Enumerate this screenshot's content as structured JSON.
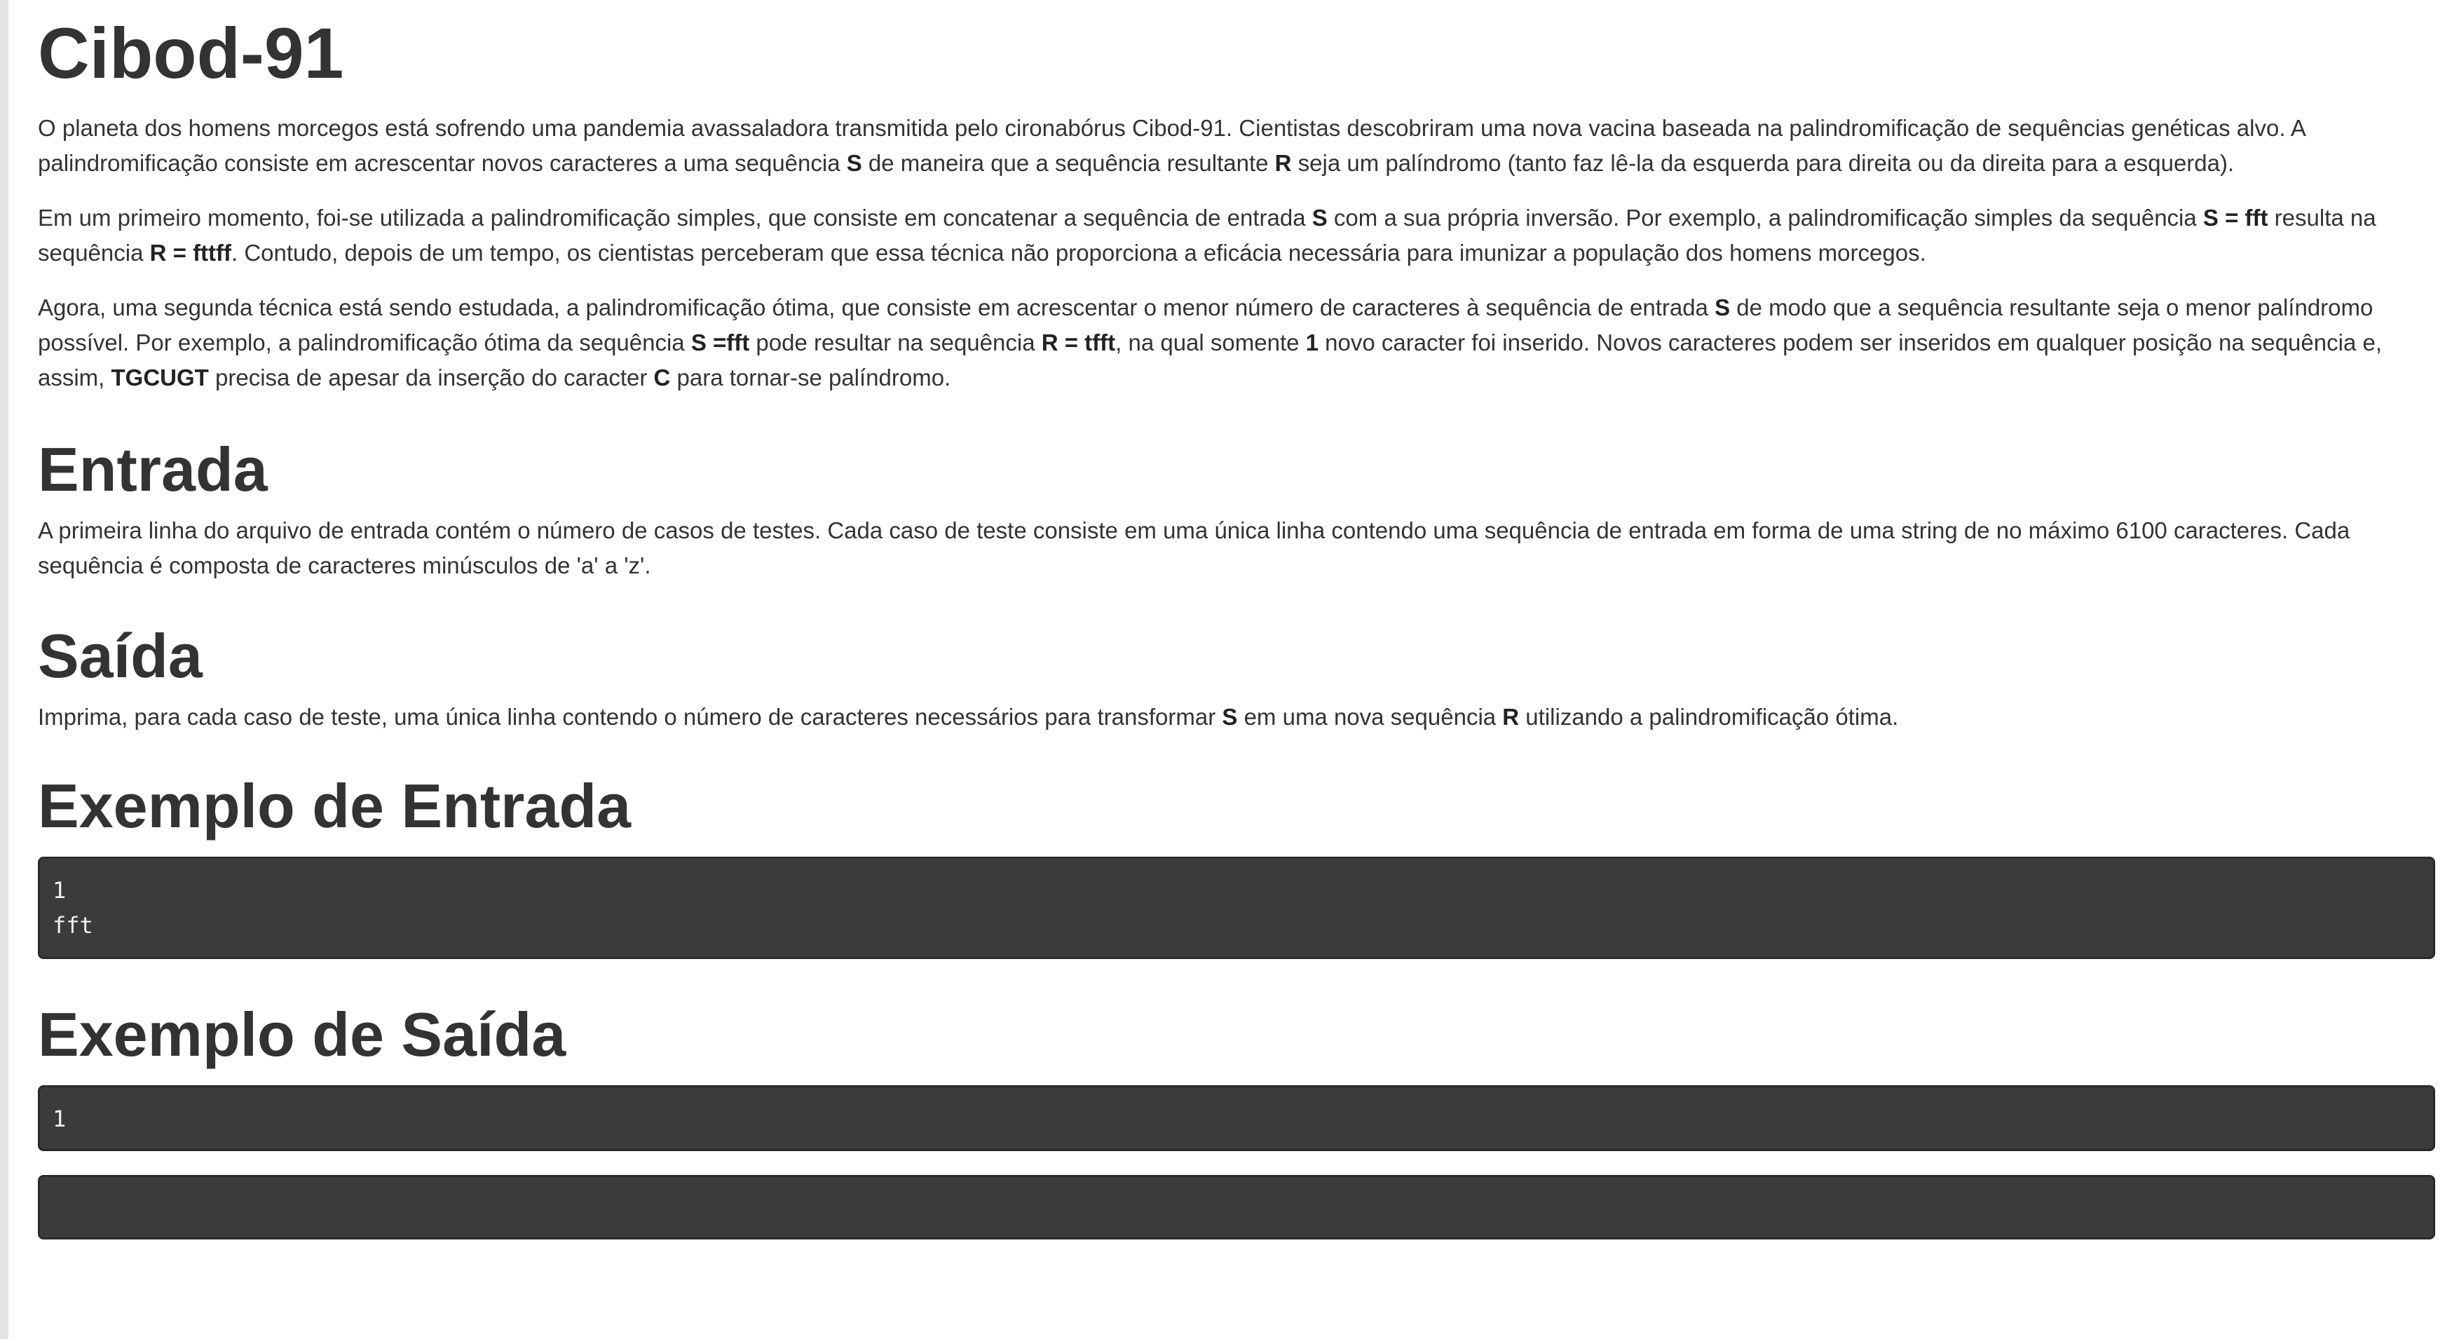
{
  "problem": {
    "title": "Cibod-91",
    "intro": [
      {
        "parts": [
          {
            "t": "O planeta dos homens morcegos está sofrendo uma pandemia avassaladora transmitida pelo cironabórus Cibod-91. Cientistas descobriram uma nova vacina baseada na palindromificação de sequências genéticas alvo. A palindromificação consiste em acrescentar novos caracteres a uma sequência "
          },
          {
            "t": "S",
            "b": true
          },
          {
            "t": " de maneira que a sequência resultante "
          },
          {
            "t": "R",
            "b": true
          },
          {
            "t": " seja um palíndromo (tanto faz lê-la da esquerda para direita ou da direita para a esquerda)."
          }
        ]
      },
      {
        "parts": [
          {
            "t": "Em um primeiro momento, foi-se utilizada a palindromificação simples, que consiste em concatenar a sequência de entrada "
          },
          {
            "t": "S",
            "b": true
          },
          {
            "t": " com a sua própria inversão. Por exemplo, a palindromificação simples da sequência "
          },
          {
            "t": "S = fft",
            "b": true
          },
          {
            "t": " resulta na sequência "
          },
          {
            "t": "R = fttff",
            "b": true
          },
          {
            "t": ". Contudo, depois de um tempo, os cientistas perceberam que essa técnica não proporciona a eficácia necessária para imunizar a população dos homens morcegos."
          }
        ]
      },
      {
        "parts": [
          {
            "t": "Agora, uma segunda técnica está sendo estudada, a palindromificação ótima, que consiste em acrescentar o menor número de caracteres à sequência de entrada "
          },
          {
            "t": "S",
            "b": true
          },
          {
            "t": " de modo que a sequência resultante seja o menor palíndromo possível. Por exemplo, a palindromificação ótima da sequência "
          },
          {
            "t": "S =fft",
            "b": true
          },
          {
            "t": " pode resultar na sequência "
          },
          {
            "t": "R = tfft",
            "b": true
          },
          {
            "t": ", na qual somente "
          },
          {
            "t": "1",
            "b": true
          },
          {
            "t": " novo caracter foi inserido. Novos caracteres podem ser inseridos em qualquer posição na sequência e, assim, "
          },
          {
            "t": "TGCUGT",
            "b": true
          },
          {
            "t": " precisa de apesar da inserção do caracter "
          },
          {
            "t": "C",
            "b": true
          },
          {
            "t": " para tornar-se palíndromo."
          }
        ]
      }
    ],
    "input": {
      "heading": "Entrada",
      "parts": [
        {
          "t": "A primeira linha do arquivo de entrada contém o número de casos de testes. Cada caso de teste consiste em uma única linha contendo uma sequência de entrada em forma de uma string de no máximo 6100 caracteres. Cada sequência é composta de caracteres minúsculos de 'a' a 'z'."
        }
      ]
    },
    "output": {
      "heading": "Saída",
      "parts": [
        {
          "t": "Imprima, para cada caso de teste, uma única linha contendo o número de caracteres necessários para transformar "
        },
        {
          "t": "S",
          "b": true
        },
        {
          "t": " em uma nova sequência "
        },
        {
          "t": "R",
          "b": true
        },
        {
          "t": " utilizando a palindromificação ótima."
        }
      ]
    },
    "sample_input": {
      "heading": "Exemplo de Entrada",
      "lines": [
        "1",
        "fft"
      ]
    },
    "sample_output": {
      "heading": "Exemplo de Saída",
      "lines": [
        "1"
      ]
    },
    "extra_box": {
      "lines": []
    }
  },
  "colors": {
    "text": "#333333",
    "code_background": "#3b3b3b",
    "code_text": "#f0f0f0",
    "left_rule": "#e3e3e3"
  }
}
